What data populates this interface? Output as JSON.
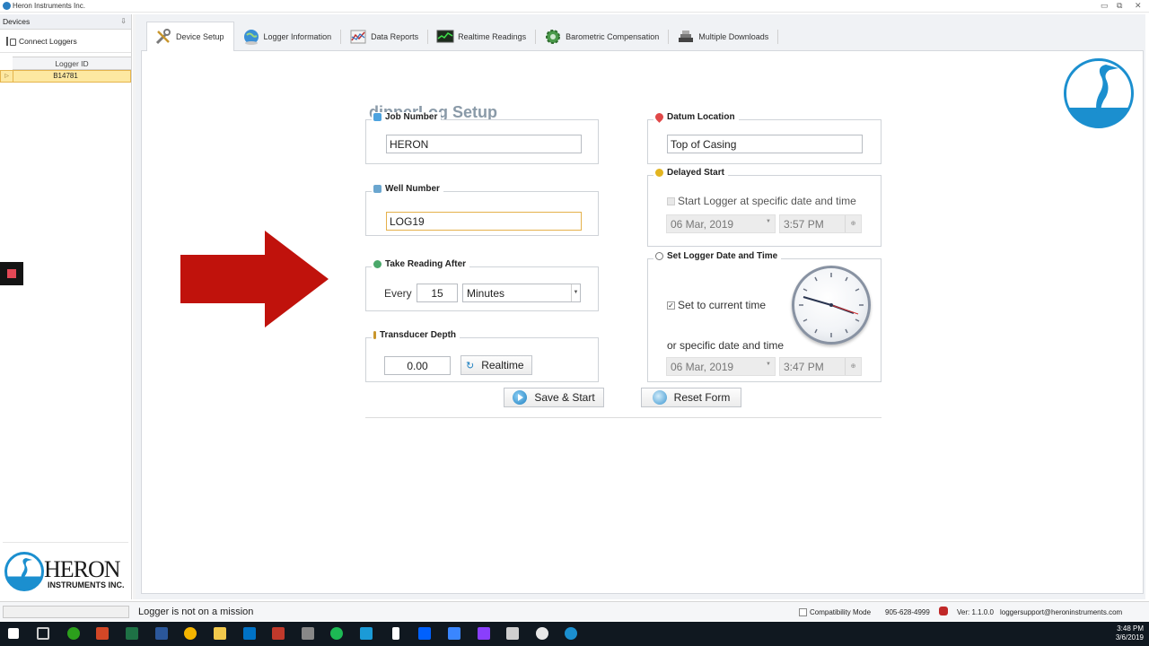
{
  "window": {
    "title": "Heron Instruments Inc.",
    "minimize_glyph": "▭",
    "maximize_glyph": "⧉",
    "close_glyph": "✕"
  },
  "devices_panel": {
    "title": "Devices",
    "pin_glyph": "⇩",
    "connect_label": "Connect Loggers",
    "column_header": "Logger ID",
    "rows": [
      {
        "indicator": "▷",
        "logger_id": "B14781",
        "selected": true
      }
    ],
    "logo_text": "HERON",
    "logo_subtext": "INSTRUMENTS INC."
  },
  "tabs": [
    {
      "label": "Device Setup",
      "active": true,
      "icon": "tools-icon"
    },
    {
      "label": "Logger Information",
      "active": false,
      "icon": "globe-icon"
    },
    {
      "label": "Data Reports",
      "active": false,
      "icon": "chart-icon"
    },
    {
      "label": "Realtime Readings",
      "active": false,
      "icon": "monitor-icon"
    },
    {
      "label": "Barometric Compensation",
      "active": false,
      "icon": "gear-icon"
    },
    {
      "label": "Multiple Downloads",
      "active": false,
      "icon": "stack-icon"
    }
  ],
  "setup": {
    "title": "dipperLog Setup",
    "job_number": {
      "label": "Job Number",
      "value": "HERON"
    },
    "well_number": {
      "label": "Well Number",
      "value": "LOG19"
    },
    "take_reading": {
      "label": "Take Reading After",
      "every_label": "Every",
      "interval_value": "15",
      "unit_value": "Minutes"
    },
    "transducer_depth": {
      "label": "Transducer Depth",
      "value": "0.00",
      "realtime_label": "Realtime"
    },
    "datum_location": {
      "label": "Datum Location",
      "value": "Top of Casing"
    },
    "delayed_start": {
      "label": "Delayed Start",
      "checkbox_label": "Start Logger at specific date and time",
      "checked": false,
      "date": "06 Mar, 2019",
      "time": "3:57 PM"
    },
    "set_datetime": {
      "label": "Set Logger Date and Time",
      "current_label": "Set to current time",
      "current_checked": true,
      "specific_label": "or specific date and time",
      "date": "06 Mar, 2019",
      "time": "3:47 PM"
    },
    "actions": {
      "save_label": "Save & Start",
      "reset_label": "Reset Form"
    }
  },
  "status_bar": {
    "message": "Logger is not on a mission",
    "compatibility_label": "Compatibility Mode",
    "phone": "905-628-4999",
    "version": "Ver: 1.1.0.0",
    "email": "loggersupport@heroninstruments.com"
  },
  "taskbar": {
    "time": "3:48 PM",
    "date": "3/6/2019"
  },
  "colors": {
    "accent_blue": "#1b8fcf",
    "arrow_red": "#c0120c",
    "selection_yellow": "#fde8a1",
    "title_gray": "#8a9aa8"
  }
}
